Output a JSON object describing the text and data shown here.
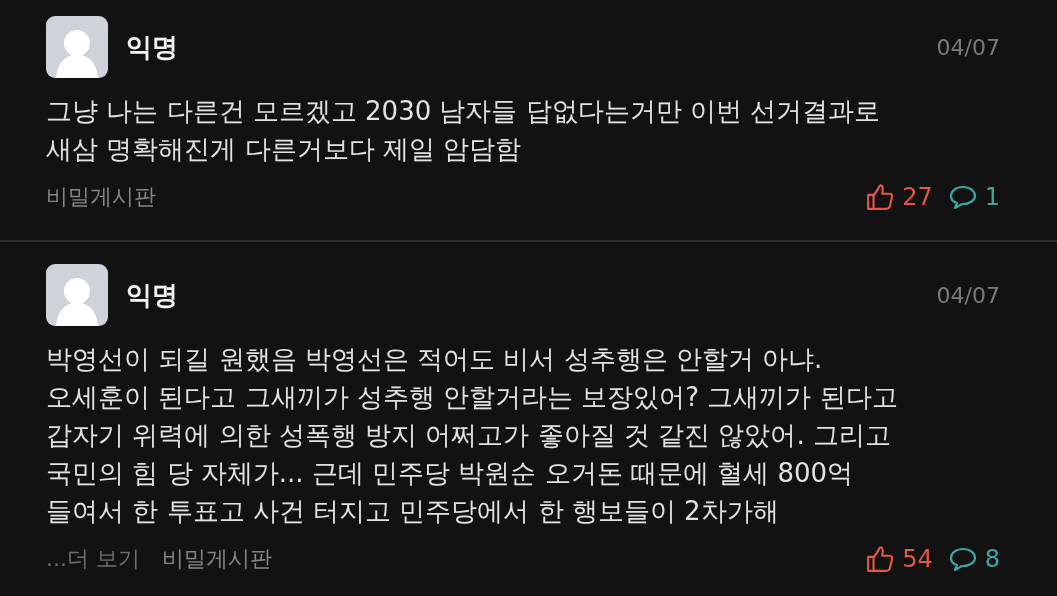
{
  "posts": [
    {
      "author": "익명",
      "date": "04/07",
      "body": "그냥 나는 다른건 모르겠고 2030 남자들 답없다는거만 이번 선거결과로\n새삼 명확해진게 다른거보다 제일 암담함",
      "board": "비밀게시판",
      "likes": "27",
      "comments": "1"
    },
    {
      "author": "익명",
      "date": "04/07",
      "body": "박영선이 되길 원했음 박영선은 적어도 비서 성추행은 안할거 아냐.\n오세훈이 된다고 그새끼가 성추행 안할거라는 보장있어? 그새끼가 된다고\n갑자기 위력에 의한 성폭행 방지 어쩌고가 좋아질 것 같진 않았어. 그리고\n국민의 힘 당 자체가... 근데 민주당 박원순 오거돈 때문에 혈세 800억\n들여서 한 투표고 사건 터지고 민주당에서 한 행보들이 2차가해",
      "more": "...더 보기",
      "board": "비밀게시판",
      "likes": "54",
      "comments": "8"
    }
  ]
}
